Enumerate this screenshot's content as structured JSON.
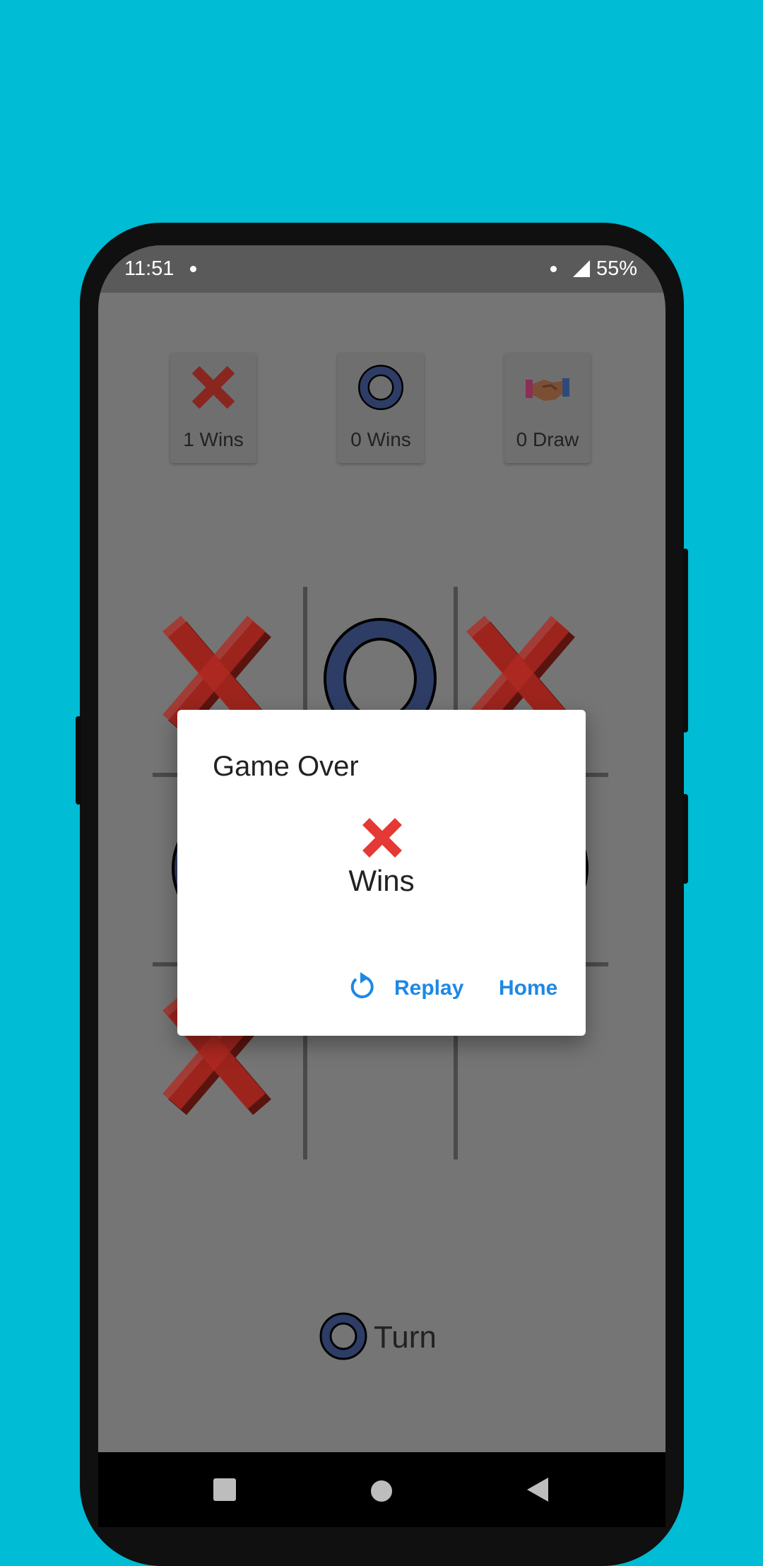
{
  "status_bar": {
    "time": "11:51",
    "battery": "55%"
  },
  "scores": [
    {
      "icon": "red-x-icon",
      "label": "1 Wins"
    },
    {
      "icon": "blue-o-icon",
      "label": "0 Wins"
    },
    {
      "icon": "handshake-icon",
      "label": "0 Draw"
    }
  ],
  "board": [
    "X",
    "O",
    "X",
    "O",
    "",
    "O",
    "X",
    "",
    ""
  ],
  "turn": {
    "icon": "blue-o-icon",
    "label": "Turn"
  },
  "dialog": {
    "title": "Game Over",
    "winner_icon": "red-x-icon",
    "winner_label": "Wins",
    "replay_label": "Replay",
    "home_label": "Home"
  },
  "colors": {
    "background": "#00BCD4",
    "x_color": "#B22A22",
    "o_color": "#2E3D66",
    "accent": "#1E88E5"
  }
}
